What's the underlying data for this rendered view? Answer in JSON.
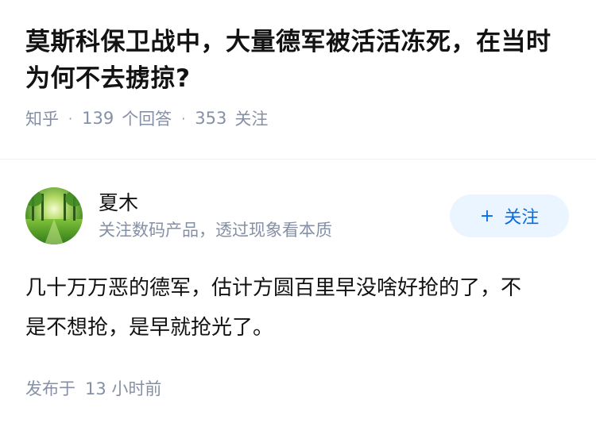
{
  "question": {
    "title": "莫斯科保卫战中，大量德军被活活冻死，在当时为何不去掳掠?",
    "source": "知乎",
    "answer_count": "139",
    "answer_label": "个回答",
    "follower_count": "353",
    "follower_label": "关注"
  },
  "answer": {
    "author": {
      "name": "夏木",
      "bio": "关注数码产品，透过现象看本质",
      "avatar_icon": "green-meadow-avatar"
    },
    "follow_button": {
      "icon": "+",
      "label": "关注"
    },
    "content": "几十万万恶的德军，估计方圆百里早没啥好抢的了，不是不想抢，是早就抢光了。",
    "time_prefix": "发布于",
    "time_value": "13 小时前"
  },
  "colors": {
    "accent": "#056de8",
    "button_bg": "#ebf5ff",
    "meta_text": "#8590a6",
    "main_text": "#121212"
  }
}
